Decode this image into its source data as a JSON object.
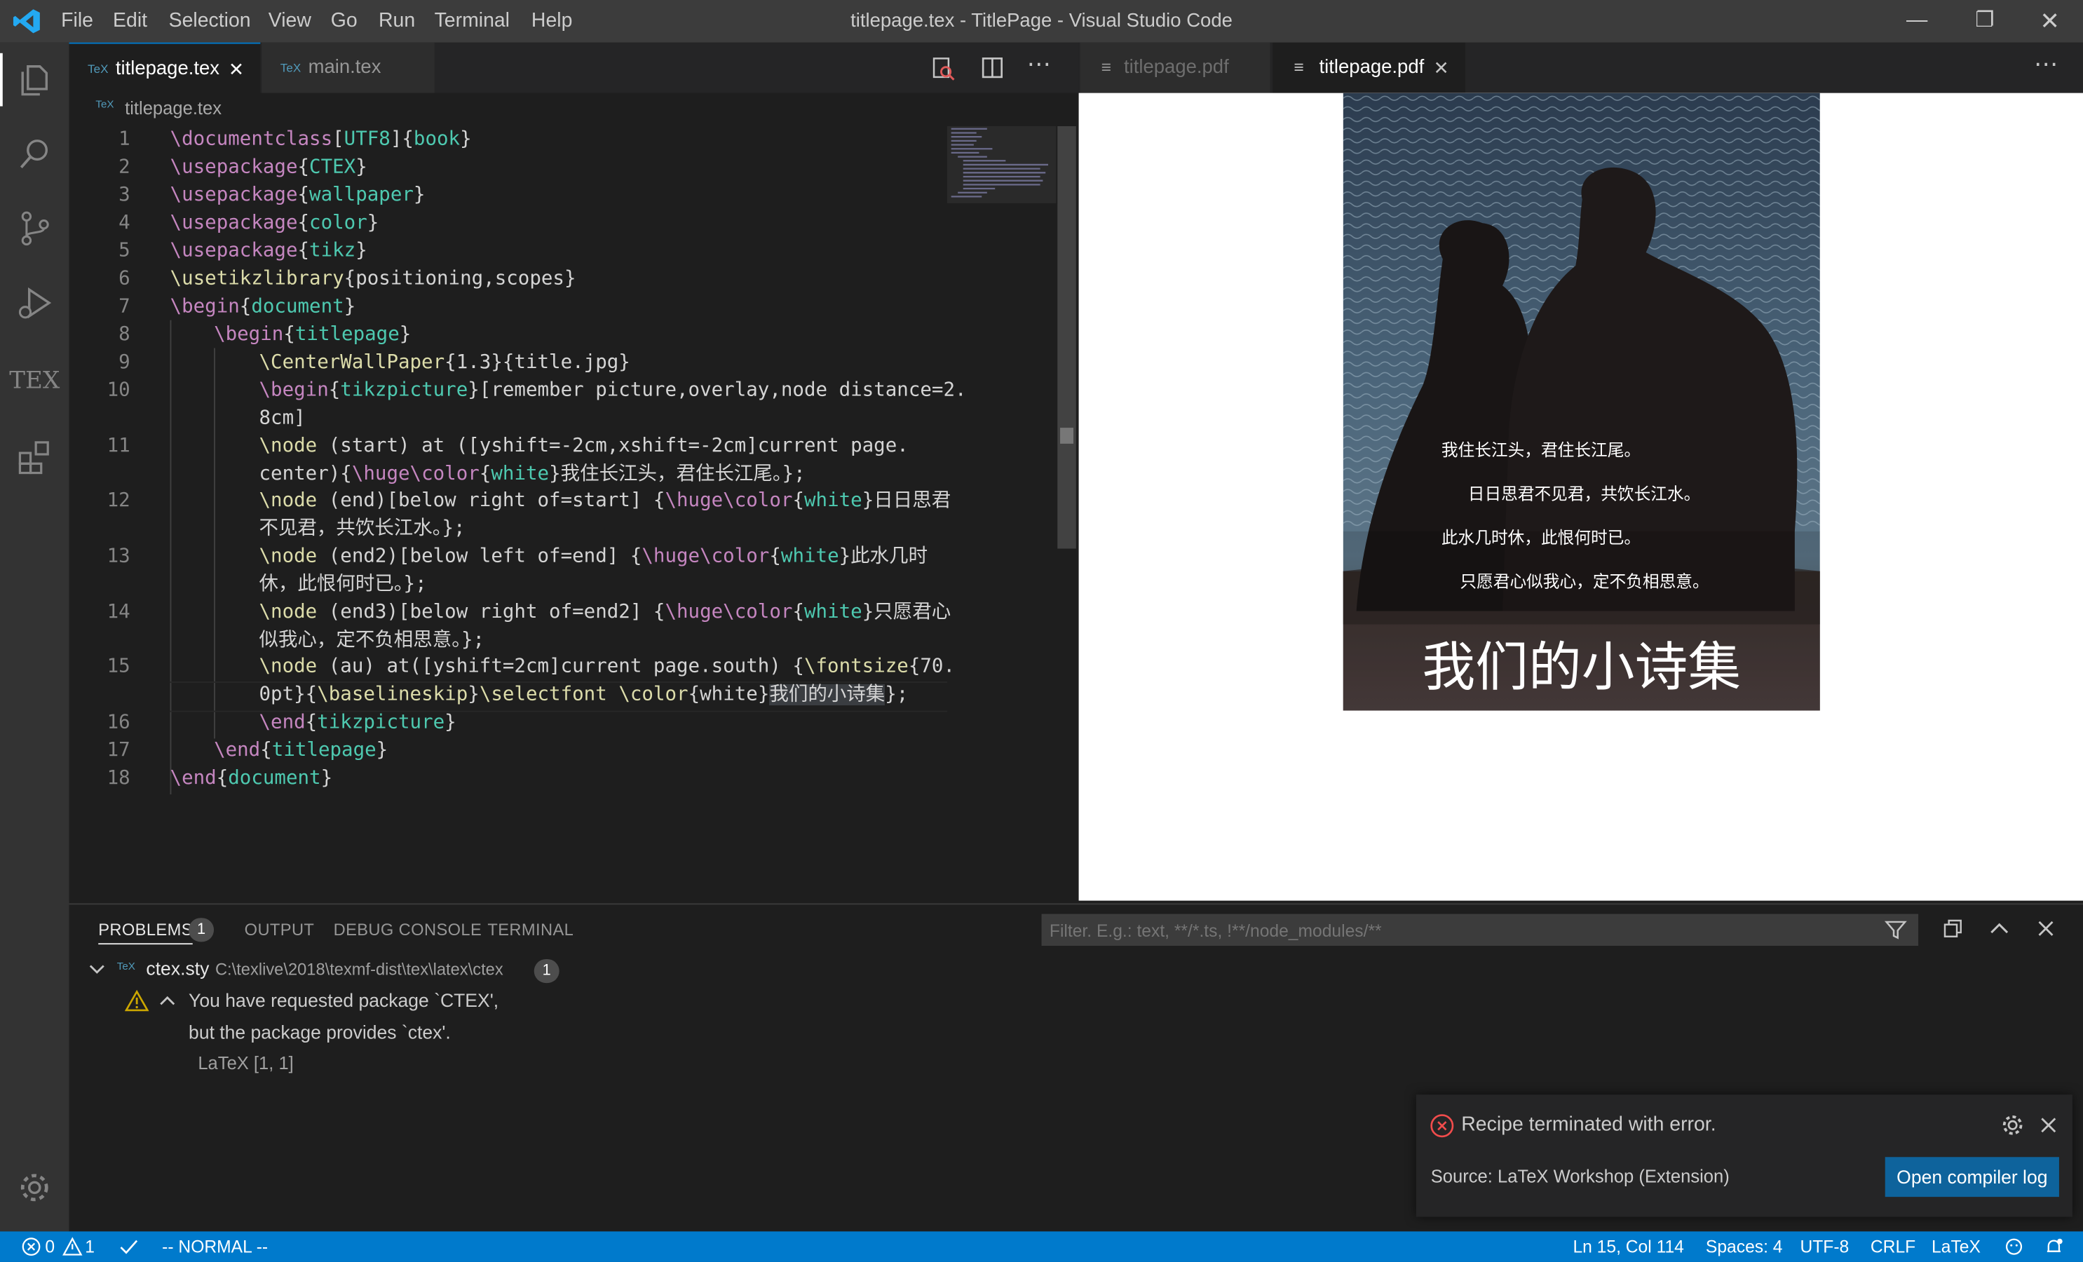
{
  "window": {
    "title": "titlepage.tex - TitlePage - Visual Studio Code",
    "menu": [
      "File",
      "Edit",
      "Selection",
      "View",
      "Go",
      "Run",
      "Terminal",
      "Help"
    ],
    "controls": {
      "minimize": "—",
      "restore": "❐",
      "close": "✕"
    }
  },
  "activity_bar": {
    "items": [
      "explorer-icon",
      "search-icon",
      "source-control-icon",
      "run-debug-icon",
      "tex-icon",
      "extensions-icon"
    ],
    "tex_label": "TEX",
    "bottom": "manage-gear-icon"
  },
  "editor": {
    "tabs": [
      {
        "icon": "TeX",
        "label": "titlepage.tex",
        "active": true
      },
      {
        "icon": "TeX",
        "label": "main.tex",
        "active": false
      }
    ],
    "breadcrumb": "titlepage.tex",
    "line_numbers": [
      "1",
      "2",
      "3",
      "4",
      "5",
      "6",
      "7",
      "8",
      "9",
      "10",
      "11",
      "12",
      "13",
      "14",
      "15",
      "16",
      "17",
      "18"
    ],
    "lines": {
      "l1": [
        "\\documentclass",
        "[",
        "UTF8",
        "]{",
        "book",
        "}"
      ],
      "l2": [
        "\\usepackage",
        "{",
        "CTEX",
        "}"
      ],
      "l3": [
        "\\usepackage",
        "{",
        "wallpaper",
        "}"
      ],
      "l4": [
        "\\usepackage",
        "{",
        "color",
        "}"
      ],
      "l5": [
        "\\usepackage",
        "{",
        "tikz",
        "}"
      ],
      "l6": [
        "\\usetikzlibrary",
        "{positioning,scopes}"
      ],
      "l7": [
        "\\begin",
        "{",
        "document",
        "}"
      ],
      "l8": [
        "\\begin",
        "{",
        "titlepage",
        "}"
      ],
      "l9": [
        "\\CenterWallPaper",
        "{1.3}{title.jpg}"
      ],
      "l10a": [
        "\\begin",
        "{",
        "tikzpicture",
        "}[remember picture,overlay,node distance=2."
      ],
      "l10b": "8cm]",
      "l11a": [
        "\\node",
        " (start) at ([yshift=-2cm,xshift=-2cm]current page."
      ],
      "l11b": [
        "center){",
        "\\huge",
        "\\color",
        "{",
        "white",
        "}我住长江头，君住长江尾。};"
      ],
      "l12a": [
        "\\node",
        " (end)[below right of=start] {",
        "\\huge",
        "\\color",
        "{",
        "white",
        "}日日思君"
      ],
      "l12b": "不见君，共饮长江水。};",
      "l13a": [
        "\\node",
        " (end2)[below left of=end] {",
        "\\huge",
        "\\color",
        "{",
        "white",
        "}此水几时"
      ],
      "l13b": "休，此恨何时已。};",
      "l14a": [
        "\\node",
        " (end3)[below right of=end2] {",
        "\\huge",
        "\\color",
        "{",
        "white",
        "}只愿君心"
      ],
      "l14b": "似我心，定不负相思意。};",
      "l15a": [
        "\\node",
        " (au) at([yshift=2cm]current page.south) {",
        "\\fontsize",
        "{70."
      ],
      "l15b": [
        "0pt}{",
        "\\baselineskip",
        "}",
        "\\selectfont",
        " ",
        "\\color",
        "{white}",
        "我们的小诗集",
        "};"
      ],
      "l16": [
        "\\end",
        "{",
        "tikzpicture",
        "}"
      ],
      "l17": [
        "\\end",
        "{",
        "titlepage",
        "}"
      ],
      "l18": [
        "\\end",
        "{",
        "document",
        "}"
      ]
    }
  },
  "pdf_viewer": {
    "tabs": [
      {
        "label": "titlepage.pdf",
        "active": false
      },
      {
        "label": "titlepage.pdf",
        "active": true
      }
    ],
    "poem": [
      "我住长江头，君住长江尾。",
      "日日思君不见君，共饮长江水。",
      "此水几时休，此恨何时已。",
      "只愿君心似我心，定不负相思意。"
    ],
    "cover_title": "我们的小诗集"
  },
  "panel": {
    "tabs": [
      "PROBLEMS",
      "OUTPUT",
      "DEBUG CONSOLE",
      "TERMINAL"
    ],
    "problems_count": "1",
    "filter_placeholder": "Filter. E.g.: text, **/*.ts, !**/node_modules/**",
    "file": {
      "name": "ctex.sty",
      "path": "C:\\texlive\\2018\\texmf-dist\\tex\\latex\\ctex",
      "count": "1"
    },
    "problem": {
      "line1": "You have requested package `CTEX',",
      "line2": "but the package provides `ctex'.",
      "source": "LaTeX",
      "position": "[1, 1]"
    }
  },
  "notification": {
    "message": "Recipe terminated with error.",
    "source": "Source: LaTeX Workshop (Extension)",
    "button": "Open compiler log"
  },
  "status_bar": {
    "errors": "0",
    "warnings": "1",
    "mode": "-- NORMAL --",
    "position": "Ln 15, Col 114",
    "spaces": "Spaces: 4",
    "encoding": "UTF-8",
    "eol": "CRLF",
    "language": "LaTeX"
  },
  "colors": {
    "accent": "#007acc",
    "titlebar": "#3c3c3c",
    "editor_bg": "#1e1e1e",
    "keyword": "#c586c0",
    "argument": "#4ec9b0"
  }
}
